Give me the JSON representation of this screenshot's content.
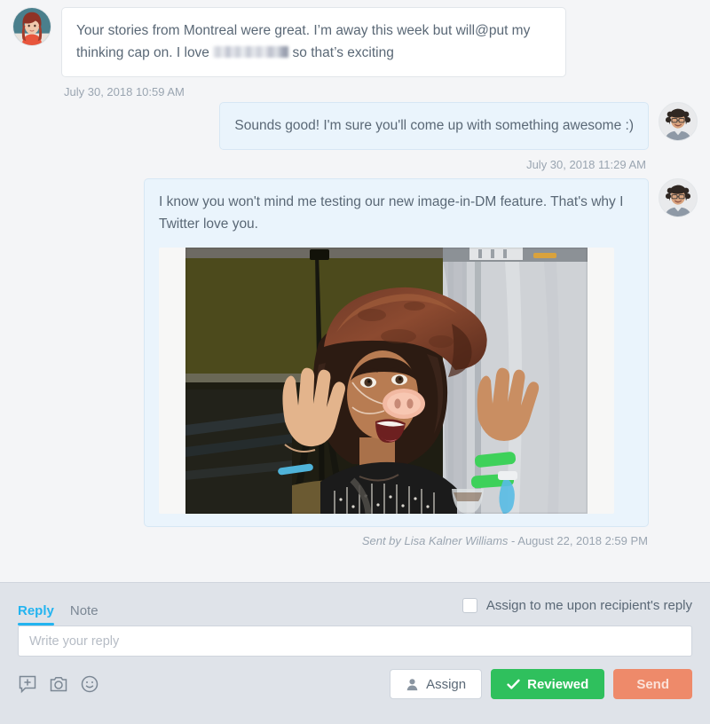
{
  "conversation": {
    "messages": [
      {
        "direction": "inbound",
        "text_before": "Your stories from Montreal were great. I’m away this week but will@put my thinking cap on. I love ",
        "redacted": true,
        "text_after": " so that’s exciting",
        "timestamp": "July 30, 2018 10:59 AM",
        "avatar_name": "contact-avatar"
      },
      {
        "direction": "outbound",
        "text": "Sounds good! I'm sure you'll come up with something awesome :)",
        "timestamp": "July 30, 2018 11:29 AM",
        "avatar_name": "agent-avatar"
      },
      {
        "direction": "outbound",
        "text": "I know you won't mind me testing our new image-in-DM feature. That's why I Twitter love you.",
        "attachment": {
          "type": "image",
          "alt": "Woman wearing a brown pirate hat and a pig-nose mask making a funny face with hands raised"
        },
        "sent_by_prefix": "Sent by Lisa Kalner Williams",
        "sent_by_separator": " - ",
        "sent_by_date": "August 22, 2018 2:59 PM",
        "avatar_name": "agent-avatar"
      }
    ]
  },
  "reply_panel": {
    "tabs": [
      {
        "label": "Reply",
        "active": true
      },
      {
        "label": "Note",
        "active": false
      }
    ],
    "assign_checkbox": {
      "label": "Assign to me upon recipient's reply",
      "checked": false
    },
    "input": {
      "value": "",
      "placeholder": "Write your reply"
    },
    "tool_icons": [
      "saved-reply-icon",
      "camera-icon",
      "emoji-icon"
    ],
    "buttons": {
      "assign": "Assign",
      "reviewed": "Reviewed",
      "send": "Send"
    }
  },
  "colors": {
    "conversation_bg": "#f4f5f7",
    "reply_panel_bg": "#dfe3e9",
    "inbound_bubble": "#ffffff",
    "outbound_bubble": "#eaf4fc",
    "accent_tab": "#23b4f0",
    "reviewed_green": "#2fc05d",
    "send_coral": "#ee8a6a",
    "text_primary": "#5a6876",
    "text_muted": "#9aa5b1"
  }
}
